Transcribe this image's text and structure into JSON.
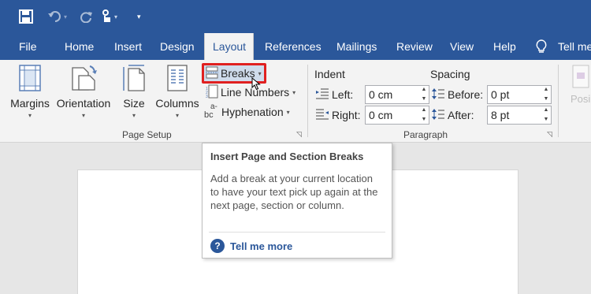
{
  "quick_access": {
    "save_icon": "save-icon",
    "undo_icon": "undo-icon",
    "redo_icon": "redo-icon",
    "touch_icon": "touch-mode-icon",
    "customize_icon": "customize-qat-icon"
  },
  "tabs": [
    {
      "label": "File"
    },
    {
      "label": "Home"
    },
    {
      "label": "Insert"
    },
    {
      "label": "Design"
    },
    {
      "label": "Layout",
      "active": true
    },
    {
      "label": "References"
    },
    {
      "label": "Mailings"
    },
    {
      "label": "Review"
    },
    {
      "label": "View"
    },
    {
      "label": "Help"
    },
    {
      "label": "Tell me"
    }
  ],
  "page_setup": {
    "margins": "Margins",
    "orientation": "Orientation",
    "size": "Size",
    "columns": "Columns",
    "breaks": "Breaks",
    "line_numbers": "Line Numbers",
    "hyphenation": "Hyphenation",
    "group_label": "Page Setup"
  },
  "paragraph": {
    "indent_heading": "Indent",
    "spacing_heading": "Spacing",
    "left_label": "Left:",
    "left_value": "0 cm",
    "right_label": "Right:",
    "right_value": "0 cm",
    "before_label": "Before:",
    "before_value": "0 pt",
    "after_label": "After:",
    "after_value": "8 pt",
    "group_label": "Paragraph"
  },
  "arrange": {
    "position_label": "Posi"
  },
  "tooltip": {
    "title": "Insert Page and Section Breaks",
    "body": "Add a break at your current location to have your text pick up again at the next page, section or column.",
    "more_label": "Tell me more"
  },
  "colors": {
    "ribbon_blue": "#2b579a",
    "highlight_red": "#e02020"
  }
}
